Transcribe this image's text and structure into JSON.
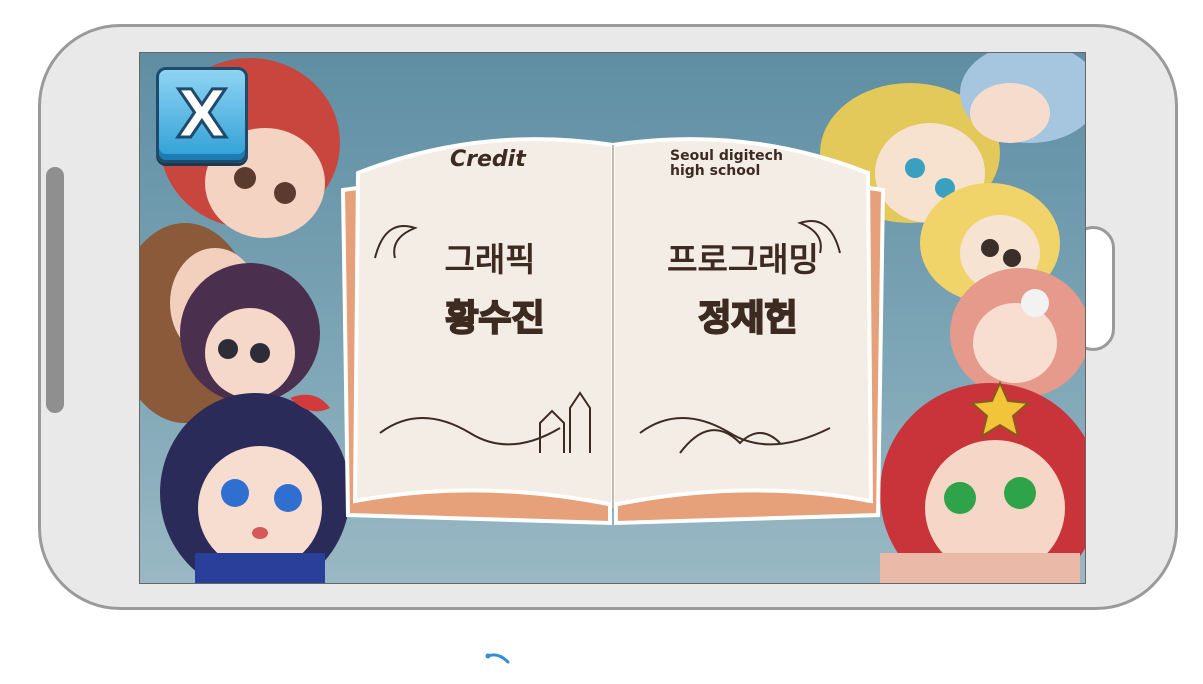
{
  "game": {
    "close_button_label": "X",
    "book": {
      "left_page": {
        "title": "Credit",
        "role": "그래픽",
        "name": "황수진"
      },
      "right_page": {
        "subtitle_line1": "Seoul digitech",
        "subtitle_line2": "high school",
        "role": "프로그래밍",
        "name": "정재헌"
      }
    }
  },
  "colors": {
    "phone_frame": "#e9e9e9",
    "phone_border": "#9a9a9a",
    "screen_background": "#6f9aad",
    "book_page": "#f3ede6",
    "book_cover": "#e6a07a",
    "close_button": "#3aa9de",
    "ink": "#3d2b22"
  },
  "icons": [
    "close-x-icon",
    "loading-spinner-icon"
  ]
}
